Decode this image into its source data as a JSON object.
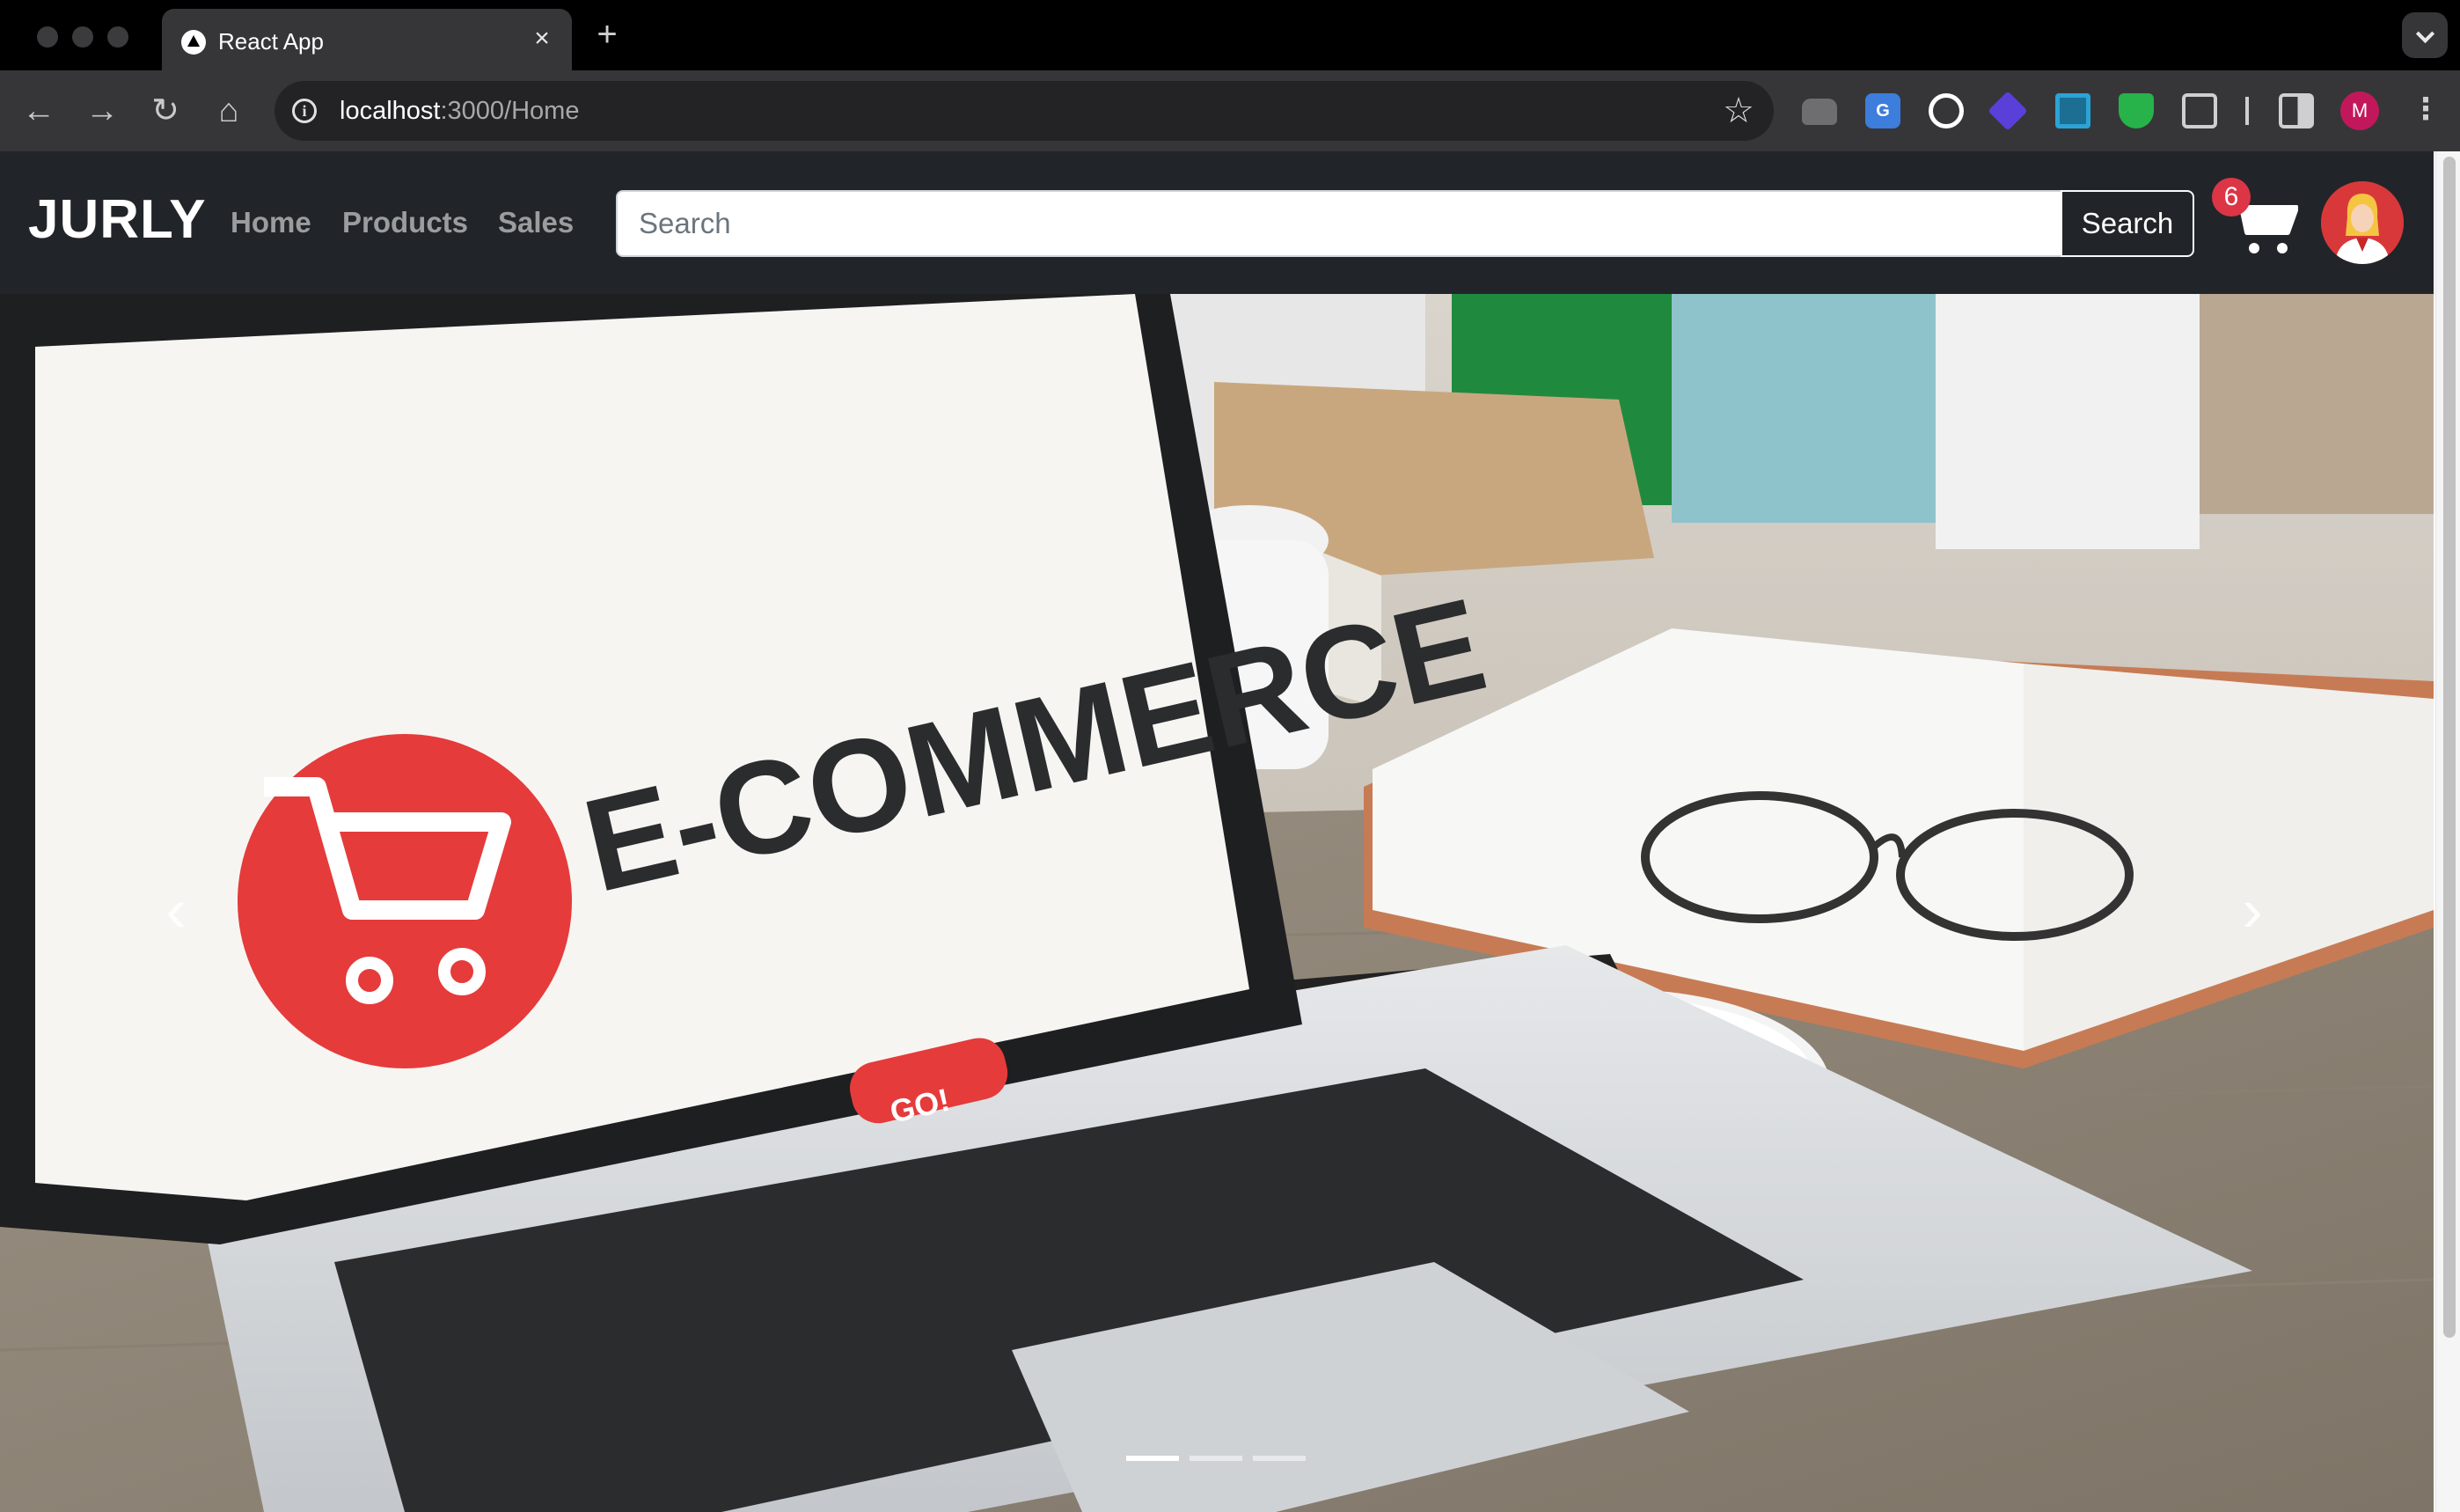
{
  "browser": {
    "tab_title": "React App",
    "tab_close": "×",
    "new_tab": "+",
    "url_host": "localhost",
    "url_path": ":3000/Home",
    "profile_initial": "M",
    "nav_back": "←",
    "nav_forward": "→",
    "nav_reload": "↻",
    "nav_home": "⌂",
    "bookmark": "☆",
    "menu": "⋮"
  },
  "navbar": {
    "brand": "JURLY",
    "links": [
      "Home",
      "Products",
      "Sales"
    ],
    "search_placeholder": "Search",
    "search_button": "Search",
    "cart_count": "6"
  },
  "carousel": {
    "laptop_screen_headline": "E-COMMERCE",
    "laptop_screen_button": "GO!",
    "prev_label": "‹",
    "next_label": "›",
    "slide_count": 3,
    "active_slide": 1
  }
}
